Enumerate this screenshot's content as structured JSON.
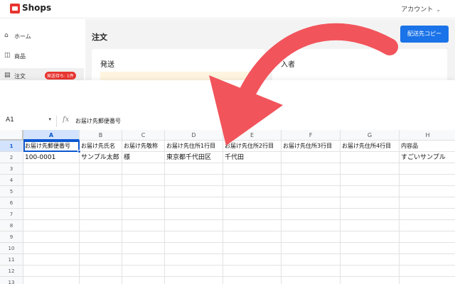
{
  "app": {
    "logo_text": "Shops",
    "account_label": "アカウント",
    "account_chevron": "⌄",
    "accent_color": "#e8342f",
    "primary_color": "#1a73e8"
  },
  "sidebar": {
    "items": [
      {
        "icon": "home-icon",
        "glyph": "⌂",
        "label": "ホーム"
      },
      {
        "icon": "camera-icon",
        "glyph": "◫",
        "label": "商品"
      },
      {
        "icon": "order-icon",
        "glyph": "▤",
        "label": "注文",
        "badge": "発送待ち: 1件"
      }
    ]
  },
  "order_page": {
    "title": "注文",
    "copy_button": "配送先コピー",
    "shipping_card_title": "発送",
    "buyer_card_title_partial": "入者"
  },
  "spreadsheet": {
    "name_box": "A1",
    "name_box_dropdown": "▾",
    "fx_label": "fx",
    "formula_value": "お届け先郵便番号",
    "columns": [
      "A",
      "B",
      "C",
      "D",
      "E",
      "F",
      "G",
      "H"
    ],
    "selected_column": "A",
    "rows": [
      "1",
      "2",
      "3",
      "4",
      "5",
      "6",
      "7",
      "8",
      "9",
      "10",
      "11",
      "12",
      "13"
    ],
    "selected_row": "1",
    "header_row": [
      "お届け先郵便番号",
      "お届け先氏名",
      "お届け先敬称",
      "お届け先住所1行目",
      "お届け先住所2行目",
      "お届け先住所3行目",
      "お届け先住所4行目",
      "内容品"
    ],
    "data_row": [
      "100-0001",
      "サンプル太郎",
      "様",
      "東京都千代田区",
      "千代田",
      "",
      "",
      "すごいサンプル"
    ]
  },
  "annotation": {
    "arrow_color": "#f2545b"
  }
}
